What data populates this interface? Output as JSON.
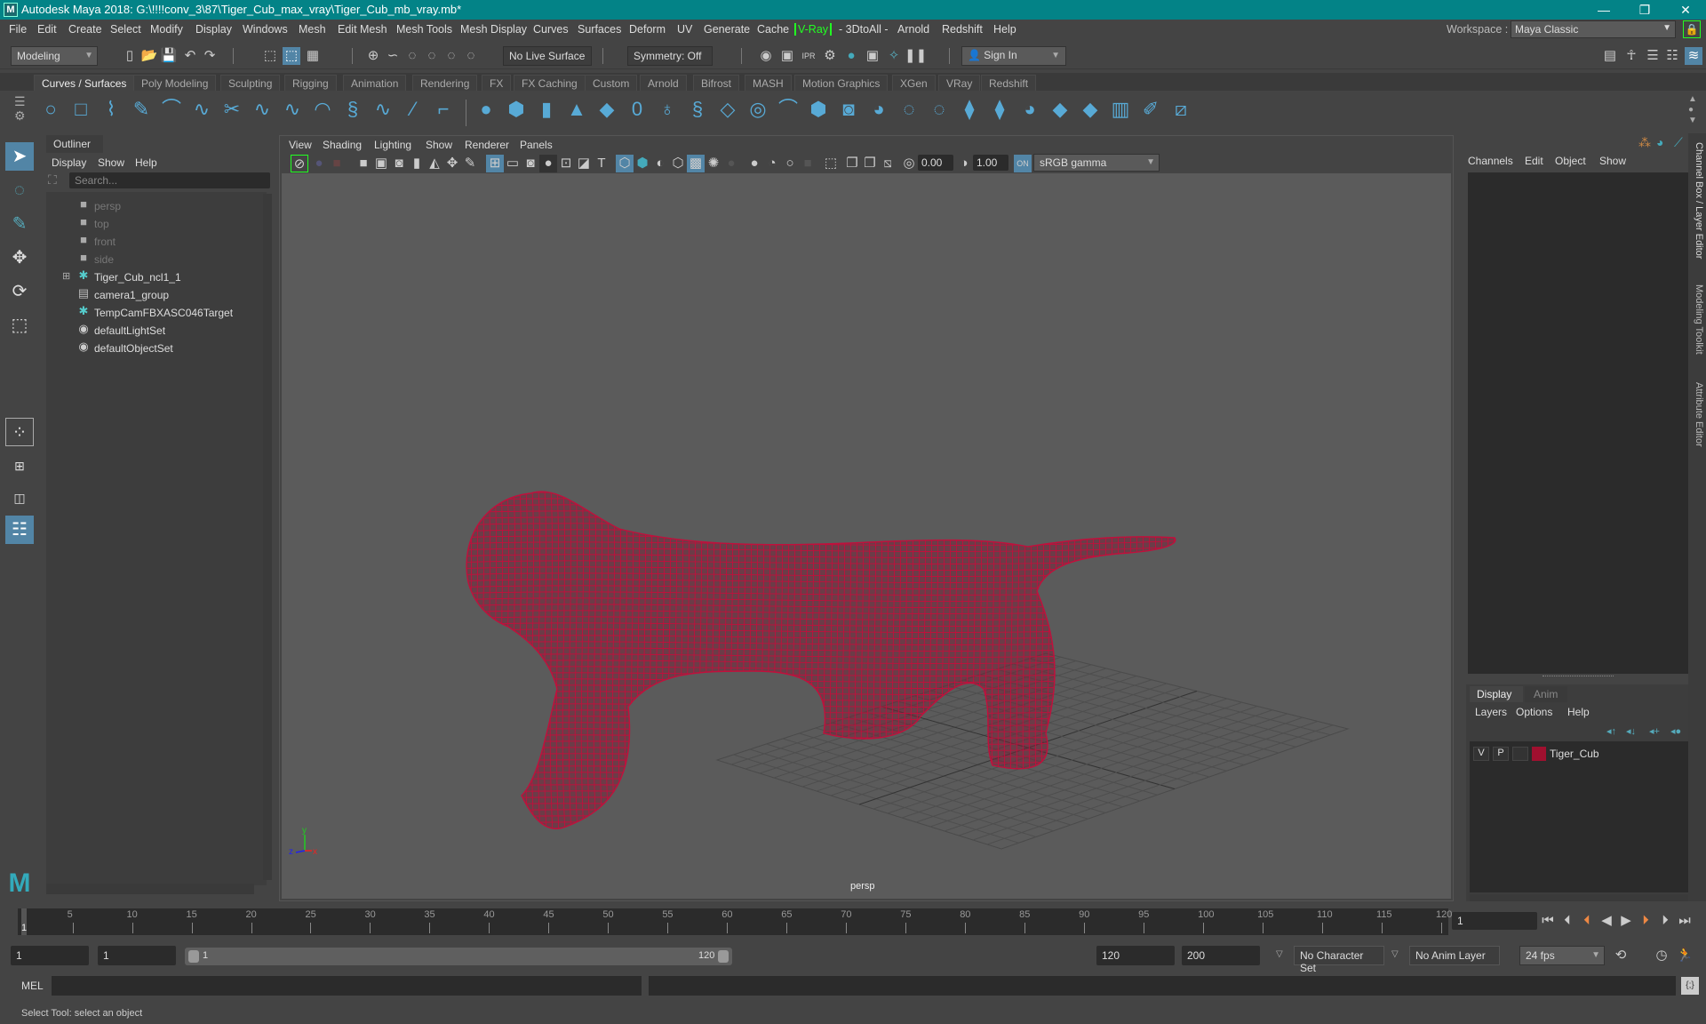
{
  "window": {
    "title": "Autodesk Maya 2018: G:\\!!!!conv_3\\87\\Tiger_Cub_max_vray\\Tiger_Cub_mb_vray.mb*",
    "logo": "M",
    "controls": {
      "minimize": "—",
      "restore": "❐",
      "close": "✕"
    }
  },
  "menubar": {
    "items": [
      "File",
      "Edit",
      "Create",
      "Select",
      "Modify",
      "Display",
      "Windows",
      "Mesh",
      "Edit Mesh",
      "Mesh Tools",
      "Mesh Display",
      "Curves",
      "Surfaces",
      "Deform",
      "UV",
      "Generate",
      "Cache",
      "V-Ray",
      "- 3DtoAll -",
      "Arnold",
      "Redshift",
      "Help"
    ],
    "workspace_label": "Workspace :",
    "workspace_value": "Maya Classic"
  },
  "statusline": {
    "menuset": "Modeling",
    "live_surface": "No Live Surface",
    "symmetry": "Symmetry: Off",
    "sign_in": "Sign In"
  },
  "shelf": {
    "tabs": [
      "Curves / Surfaces",
      "Poly Modeling",
      "Sculpting",
      "Rigging",
      "Animation",
      "Rendering",
      "FX",
      "FX Caching",
      "Custom",
      "Arnold",
      "Bifrost",
      "MASH",
      "Motion Graphics",
      "XGen",
      "VRay",
      "Redshift"
    ],
    "active_tab": "Curves / Surfaces",
    "icons": [
      "nurbs-circle",
      "nurbs-square",
      "ep-curve",
      "pencil-curve",
      "cv-curve",
      "bezier-curve",
      "cut-curve",
      "attach-curve",
      "extend-curve",
      "offset-curve",
      "arc",
      "rebuild-curve",
      "reverse-curve",
      "intersect-curve",
      "project-curve",
      "nurbs-sphere",
      "nurbs-cube",
      "nurbs-cylinder",
      "nurbs-cone",
      "nurbs-plane",
      "nurbs-torus",
      "revolve",
      "loft",
      "planar",
      "extrude",
      "birail",
      "bevel",
      "trim",
      "untrim",
      "boolean",
      "fillet",
      "stitch",
      "sculpt",
      "attach-surface",
      "detach-surface",
      "rebuild-surface",
      "paint",
      "project"
    ]
  },
  "outliner": {
    "title": "Outliner",
    "menus": [
      "Display",
      "Show",
      "Help"
    ],
    "search_placeholder": "Search...",
    "items": [
      {
        "label": "persp",
        "icon": "camera",
        "dim": true
      },
      {
        "label": "top",
        "icon": "camera",
        "dim": true
      },
      {
        "label": "front",
        "icon": "camera",
        "dim": true
      },
      {
        "label": "side",
        "icon": "camera",
        "dim": true
      },
      {
        "label": "Tiger_Cub_ncl1_1",
        "icon": "locator",
        "expandable": true
      },
      {
        "label": "camera1_group",
        "icon": "group"
      },
      {
        "label": "TempCamFBXASC046Target",
        "icon": "locator"
      },
      {
        "label": "defaultLightSet",
        "icon": "set"
      },
      {
        "label": "defaultObjectSet",
        "icon": "set"
      }
    ]
  },
  "viewport": {
    "menus": [
      "View",
      "Shading",
      "Lighting",
      "Show",
      "Renderer",
      "Panels"
    ],
    "exposure": "0.00",
    "gamma": "1.00",
    "color_management": "sRGB gamma",
    "camera_label": "persp",
    "axis": {
      "x": "x",
      "y": "y",
      "z": "z"
    },
    "wireframe_color": "#c0103c"
  },
  "channelbox": {
    "menus": [
      "Channels",
      "Edit",
      "Object",
      "Show"
    ],
    "side_tabs": [
      "Channel Box / Layer Editor",
      "Modeling Toolkit",
      "Attribute Editor"
    ]
  },
  "layers": {
    "tabs": [
      "Display",
      "Anim"
    ],
    "active_tab": "Display",
    "menus": [
      "Layers",
      "Options",
      "Help"
    ],
    "items": [
      {
        "v": "V",
        "p": "P",
        "name": "Tiger_Cub",
        "color": "#a0102f"
      }
    ]
  },
  "timeline": {
    "ticks": [
      5,
      10,
      15,
      20,
      25,
      30,
      35,
      40,
      45,
      50,
      55,
      60,
      65,
      70,
      75,
      80,
      85,
      90,
      95,
      100,
      105,
      110,
      115,
      120
    ],
    "current_frame": "1",
    "current_frame_field": "1",
    "start": 1,
    "end": 120
  },
  "range": {
    "start_time": "1",
    "playback_start": "1",
    "slider_start": "1",
    "slider_end": "120",
    "playback_end": "120",
    "end_time": "200",
    "character_set": "No Character Set",
    "anim_layer": "No Anim Layer",
    "fps": "24 fps"
  },
  "commandline": {
    "label": "MEL"
  },
  "helpline": {
    "text": "Select Tool: select an object"
  }
}
